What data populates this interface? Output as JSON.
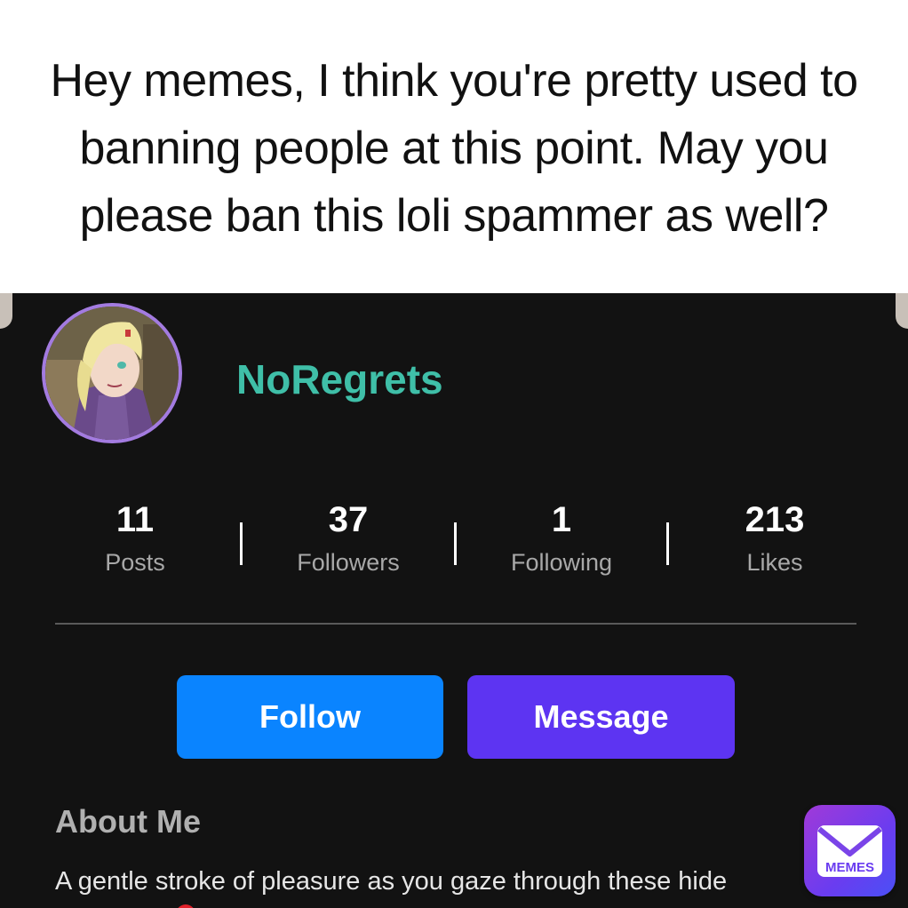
{
  "caption": "Hey memes, I think you're pretty used to banning people at this point. May you please ban this loli spammer as well?",
  "profile": {
    "username": "NoRegrets",
    "stats": [
      {
        "value": "11",
        "label": "Posts"
      },
      {
        "value": "37",
        "label": "Followers"
      },
      {
        "value": "1",
        "label": "Following"
      },
      {
        "value": "213",
        "label": "Likes"
      }
    ],
    "follow_label": "Follow",
    "message_label": "Message",
    "about_title": "About Me",
    "about_text": "A gentle stroke of pleasure as you gaze through these hide"
  },
  "badge": {
    "label": "MEMES"
  },
  "colors": {
    "username": "#3fbfa8",
    "follow": "#0a84ff",
    "message": "#5d34f2",
    "avatar_ring": "#a37be0",
    "background": "#121212"
  }
}
